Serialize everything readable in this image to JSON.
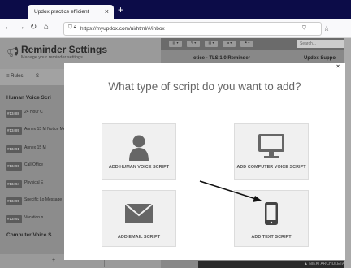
{
  "browser": {
    "tab_title": "Updox practice efficient",
    "tab_close": "×",
    "new_tab": "+",
    "url": "https://myupdox.com/ui/html/#/inbox",
    "menu_dots": "···"
  },
  "app": {
    "header_title": "Reminder Settings",
    "header_subtitle": "Manage your reminder settings",
    "tabs": [
      {
        "label": "Rules"
      },
      {
        "label": "S"
      }
    ],
    "sections": [
      {
        "label": "Human Voice Scri"
      },
      {
        "label": "Computer Voice S"
      }
    ],
    "rows": [
      {
        "id": "#13488",
        "text": "24 Hour C"
      },
      {
        "id": "#13489",
        "text": "Annex 15 M Notice Met"
      },
      {
        "id": "#13491",
        "text": "Annex 15 M"
      },
      {
        "id": "#13490",
        "text": "Call Office"
      },
      {
        "id": "#13494",
        "text": "Physical E"
      },
      {
        "id": "#13495",
        "text": "Specific Lo Message"
      },
      {
        "id": "#13492",
        "text": "Vacation n"
      }
    ],
    "right_header_left": "otice - TLS 1.0 Reminder",
    "right_header_right": "Updox Suppo",
    "search_placeholder": "Search...",
    "footer_user": "▲ NIKKI ARCHULETA ▾",
    "add_button": "+"
  },
  "modal": {
    "title": "What type of script do you want to add?",
    "close": "×",
    "cards": [
      {
        "icon": "person-icon",
        "label": "ADD HUMAN VOICE SCRIPT"
      },
      {
        "icon": "monitor-icon",
        "label": "ADD COMPUTER VOICE SCRIPT"
      },
      {
        "icon": "envelope-icon",
        "label": "ADD EMAIL SCRIPT"
      },
      {
        "icon": "mobile-phone-icon",
        "label": "ADD TEXT SCRIPT"
      }
    ]
  },
  "colors": {
    "browser_tabbar": "#0c0c48",
    "overlay": "#8c8c8c",
    "icon_gray": "#666666",
    "card_bg": "#f0f0f0"
  }
}
